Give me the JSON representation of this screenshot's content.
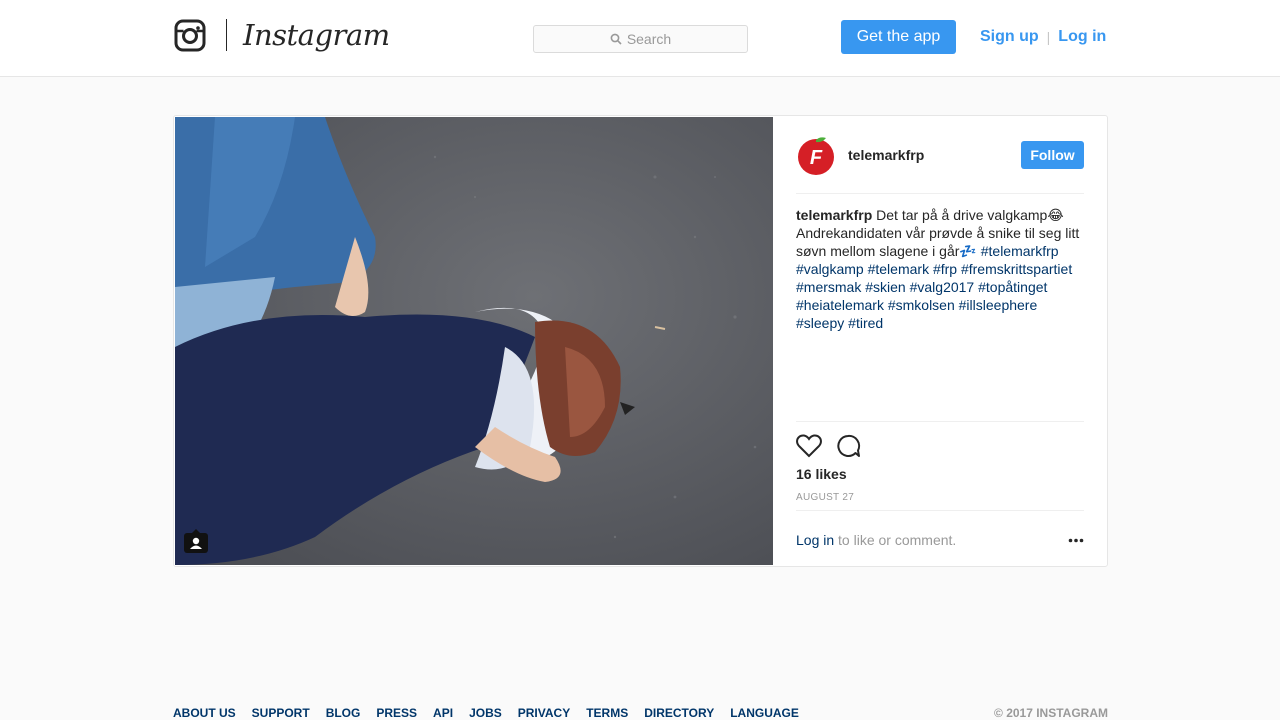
{
  "header": {
    "logo_text": "Instagram",
    "search_placeholder": "Search",
    "get_app_label": "Get the app",
    "signup_label": "Sign up",
    "separator": "|",
    "login_label": "Log in"
  },
  "post": {
    "username": "telemarkfrp",
    "follow_label": "Follow",
    "caption_user": "telemarkfrp",
    "caption_text": " Det tar på å drive valgkamp😂 Andrekandidaten vår prøvde å snike til seg litt søvn mellom slagene i går💤 ",
    "hashtags": [
      "#telemarkfrp",
      "#valgkamp",
      "#telemark",
      "#frp",
      "#fremskrittspartiet",
      "#mersmak",
      "#skien",
      "#valg2017",
      "#topåtinget",
      "#heiatelemark",
      "#smkolsen",
      "#illsleephere",
      "#sleepy",
      "#tired"
    ],
    "likes": "16 likes",
    "date": "AUGUST 27",
    "login_link": "Log in",
    "login_suffix": " to like or comment."
  },
  "footer": {
    "links": [
      "ABOUT US",
      "SUPPORT",
      "BLOG",
      "PRESS",
      "API",
      "JOBS",
      "PRIVACY",
      "TERMS",
      "DIRECTORY",
      "LANGUAGE"
    ],
    "copyright": "© 2017 INSTAGRAM"
  },
  "colors": {
    "accent": "#3897f0",
    "link": "#003569",
    "muted": "#999999",
    "border": "#e6e6e6"
  },
  "icons": [
    "instagram-glyph-icon",
    "search-icon",
    "user-tag-icon",
    "heart-icon",
    "comment-icon",
    "more-icon"
  ]
}
